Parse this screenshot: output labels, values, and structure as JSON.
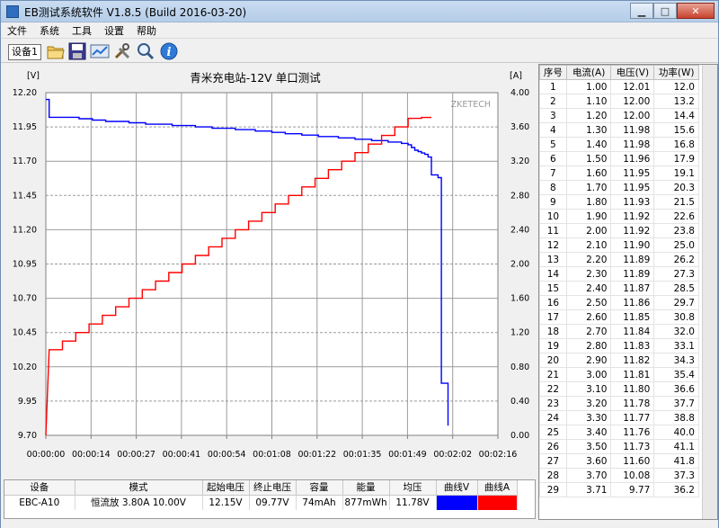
{
  "window": {
    "title": "EB测试系统软件 V1.8.5 (Build 2016-03-20)",
    "min_icon": "minimize-icon",
    "max_icon": "maximize-icon",
    "close_icon": "close-icon"
  },
  "menu": [
    "文件",
    "系统",
    "工具",
    "设置",
    "帮助"
  ],
  "toolbar": {
    "device_label": "设备1",
    "icons": [
      "open-folder-icon",
      "save-icon",
      "chart-icon",
      "tools-icon",
      "search-icon",
      "info-icon"
    ]
  },
  "chart_data": {
    "type": "line",
    "title": "青米充电站-12V 单口测试",
    "watermark": "ZKETECH",
    "left_unit": "[V]",
    "right_unit": "[A]",
    "xlabels": [
      "00:00:00",
      "00:00:14",
      "00:00:27",
      "00:00:41",
      "00:00:54",
      "00:01:08",
      "00:01:22",
      "00:01:35",
      "00:01:49",
      "00:02:02",
      "00:02:16"
    ],
    "x_range_s": [
      0,
      136
    ],
    "y_left": {
      "min": 9.7,
      "max": 12.2,
      "ticks": [
        "12.20",
        "11.95",
        "11.70",
        "11.45",
        "11.20",
        "10.95",
        "10.70",
        "10.45",
        "10.20",
        "9.95",
        "9.70"
      ]
    },
    "y_right": {
      "min": 0,
      "max": 4,
      "ticks": [
        "4.00",
        "3.60",
        "3.20",
        "2.80",
        "2.40",
        "2.00",
        "1.60",
        "1.20",
        "0.80",
        "0.40",
        "0.00"
      ]
    },
    "series": [
      {
        "name": "曲线V",
        "color": "#0000ff",
        "axis": "left",
        "points": [
          [
            0,
            12.15
          ],
          [
            1,
            12.02
          ],
          [
            10,
            12.01
          ],
          [
            14,
            12.0
          ],
          [
            18,
            11.99
          ],
          [
            25,
            11.98
          ],
          [
            30,
            11.97
          ],
          [
            38,
            11.96
          ],
          [
            45,
            11.95
          ],
          [
            50,
            11.94
          ],
          [
            57,
            11.93
          ],
          [
            63,
            11.92
          ],
          [
            68,
            11.91
          ],
          [
            72,
            11.9
          ],
          [
            77,
            11.89
          ],
          [
            82,
            11.88
          ],
          [
            88,
            11.87
          ],
          [
            93,
            11.86
          ],
          [
            98,
            11.85
          ],
          [
            103,
            11.84
          ],
          [
            107,
            11.83
          ],
          [
            109,
            11.82
          ],
          [
            110,
            11.8
          ],
          [
            111,
            11.78
          ],
          [
            112,
            11.77
          ],
          [
            113,
            11.76
          ],
          [
            114,
            11.75
          ],
          [
            115,
            11.73
          ],
          [
            116,
            11.6
          ],
          [
            118,
            11.58
          ],
          [
            119,
            10.08
          ],
          [
            121,
            10.08
          ],
          [
            121,
            9.77
          ]
        ]
      },
      {
        "name": "曲线A",
        "color": "#ff0000",
        "axis": "right",
        "points": [
          [
            0,
            0
          ],
          [
            1,
            1.0
          ],
          [
            5,
            1.0
          ],
          [
            5,
            1.1
          ],
          [
            9,
            1.1
          ],
          [
            9,
            1.2
          ],
          [
            13,
            1.2
          ],
          [
            13,
            1.3
          ],
          [
            17,
            1.3
          ],
          [
            17,
            1.4
          ],
          [
            21,
            1.4
          ],
          [
            21,
            1.5
          ],
          [
            25,
            1.5
          ],
          [
            25,
            1.6
          ],
          [
            29,
            1.6
          ],
          [
            29,
            1.7
          ],
          [
            33,
            1.7
          ],
          [
            33,
            1.8
          ],
          [
            37,
            1.8
          ],
          [
            37,
            1.9
          ],
          [
            41,
            1.9
          ],
          [
            41,
            2.0
          ],
          [
            45,
            2.0
          ],
          [
            45,
            2.1
          ],
          [
            49,
            2.1
          ],
          [
            49,
            2.2
          ],
          [
            53,
            2.2
          ],
          [
            53,
            2.3
          ],
          [
            57,
            2.3
          ],
          [
            57,
            2.4
          ],
          [
            61,
            2.4
          ],
          [
            61,
            2.5
          ],
          [
            65,
            2.5
          ],
          [
            65,
            2.6
          ],
          [
            69,
            2.6
          ],
          [
            69,
            2.7
          ],
          [
            73,
            2.7
          ],
          [
            73,
            2.8
          ],
          [
            77,
            2.8
          ],
          [
            77,
            2.9
          ],
          [
            81,
            2.9
          ],
          [
            81,
            3.0
          ],
          [
            85,
            3.0
          ],
          [
            85,
            3.1
          ],
          [
            89,
            3.1
          ],
          [
            89,
            3.2
          ],
          [
            93,
            3.2
          ],
          [
            93,
            3.3
          ],
          [
            97,
            3.3
          ],
          [
            97,
            3.4
          ],
          [
            101,
            3.4
          ],
          [
            101,
            3.5
          ],
          [
            105,
            3.5
          ],
          [
            105,
            3.6
          ],
          [
            109,
            3.6
          ],
          [
            109,
            3.7
          ],
          [
            113,
            3.7
          ],
          [
            113,
            3.71
          ],
          [
            116,
            3.71
          ]
        ]
      }
    ]
  },
  "readings": {
    "headers": [
      "序号",
      "电流(A)",
      "电压(V)",
      "功率(W)"
    ],
    "rows": [
      [
        "1",
        "1.00",
        "12.01",
        "12.0"
      ],
      [
        "2",
        "1.10",
        "12.00",
        "13.2"
      ],
      [
        "3",
        "1.20",
        "12.00",
        "14.4"
      ],
      [
        "4",
        "1.30",
        "11.98",
        "15.6"
      ],
      [
        "5",
        "1.40",
        "11.98",
        "16.8"
      ],
      [
        "6",
        "1.50",
        "11.96",
        "17.9"
      ],
      [
        "7",
        "1.60",
        "11.95",
        "19.1"
      ],
      [
        "8",
        "1.70",
        "11.95",
        "20.3"
      ],
      [
        "9",
        "1.80",
        "11.93",
        "21.5"
      ],
      [
        "10",
        "1.90",
        "11.92",
        "22.6"
      ],
      [
        "11",
        "2.00",
        "11.92",
        "23.8"
      ],
      [
        "12",
        "2.10",
        "11.90",
        "25.0"
      ],
      [
        "13",
        "2.20",
        "11.89",
        "26.2"
      ],
      [
        "14",
        "2.30",
        "11.89",
        "27.3"
      ],
      [
        "15",
        "2.40",
        "11.87",
        "28.5"
      ],
      [
        "16",
        "2.50",
        "11.86",
        "29.7"
      ],
      [
        "17",
        "2.60",
        "11.85",
        "30.8"
      ],
      [
        "18",
        "2.70",
        "11.84",
        "32.0"
      ],
      [
        "19",
        "2.80",
        "11.83",
        "33.1"
      ],
      [
        "20",
        "2.90",
        "11.82",
        "34.3"
      ],
      [
        "21",
        "3.00",
        "11.81",
        "35.4"
      ],
      [
        "22",
        "3.10",
        "11.80",
        "36.6"
      ],
      [
        "23",
        "3.20",
        "11.78",
        "37.7"
      ],
      [
        "24",
        "3.30",
        "11.77",
        "38.8"
      ],
      [
        "25",
        "3.40",
        "11.76",
        "40.0"
      ],
      [
        "26",
        "3.50",
        "11.73",
        "41.1"
      ],
      [
        "27",
        "3.60",
        "11.60",
        "41.8"
      ],
      [
        "28",
        "3.70",
        "10.08",
        "37.3"
      ],
      [
        "29",
        "3.71",
        "9.77",
        "36.2"
      ]
    ]
  },
  "summary": {
    "headers": [
      "设备",
      "模式",
      "起始电压",
      "终止电压",
      "容量",
      "能量",
      "均压",
      "曲线V",
      "曲线A"
    ],
    "device": "EBC-A10",
    "mode": "恒流放",
    "mode_params": "3.80A 10.00V",
    "start_voltage": "12.15V",
    "end_voltage": "09.77V",
    "capacity": "74mAh",
    "energy": "877mWh",
    "avg_voltage": "11.78V",
    "curve_v_color": "#0000ff",
    "curve_a_color": "#ff0000"
  }
}
